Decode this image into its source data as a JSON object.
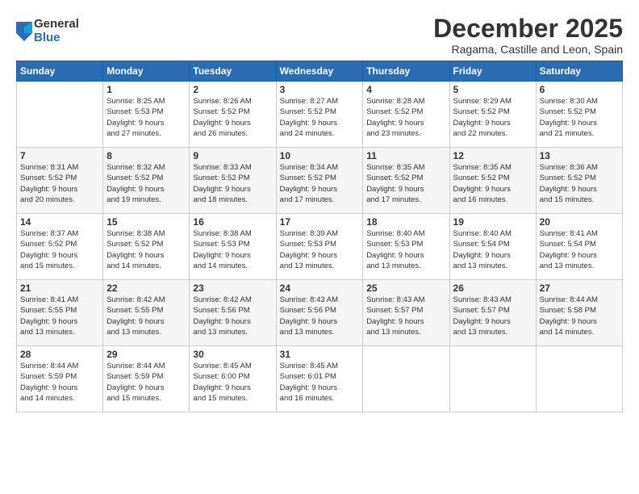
{
  "logo": {
    "general": "General",
    "blue": "Blue"
  },
  "header": {
    "title": "December 2025",
    "subtitle": "Ragama, Castille and Leon, Spain"
  },
  "weekdays": [
    "Sunday",
    "Monday",
    "Tuesday",
    "Wednesday",
    "Thursday",
    "Friday",
    "Saturday"
  ],
  "weeks": [
    [
      {
        "day": "",
        "info": ""
      },
      {
        "day": "1",
        "info": "Sunrise: 8:25 AM\nSunset: 5:53 PM\nDaylight: 9 hours\nand 27 minutes."
      },
      {
        "day": "2",
        "info": "Sunrise: 8:26 AM\nSunset: 5:52 PM\nDaylight: 9 hours\nand 26 minutes."
      },
      {
        "day": "3",
        "info": "Sunrise: 8:27 AM\nSunset: 5:52 PM\nDaylight: 9 hours\nand 24 minutes."
      },
      {
        "day": "4",
        "info": "Sunrise: 8:28 AM\nSunset: 5:52 PM\nDaylight: 9 hours\nand 23 minutes."
      },
      {
        "day": "5",
        "info": "Sunrise: 8:29 AM\nSunset: 5:52 PM\nDaylight: 9 hours\nand 22 minutes."
      },
      {
        "day": "6",
        "info": "Sunrise: 8:30 AM\nSunset: 5:52 PM\nDaylight: 9 hours\nand 21 minutes."
      }
    ],
    [
      {
        "day": "7",
        "info": "Sunrise: 8:31 AM\nSunset: 5:52 PM\nDaylight: 9 hours\nand 20 minutes."
      },
      {
        "day": "8",
        "info": "Sunrise: 8:32 AM\nSunset: 5:52 PM\nDaylight: 9 hours\nand 19 minutes."
      },
      {
        "day": "9",
        "info": "Sunrise: 8:33 AM\nSunset: 5:52 PM\nDaylight: 9 hours\nand 18 minutes."
      },
      {
        "day": "10",
        "info": "Sunrise: 8:34 AM\nSunset: 5:52 PM\nDaylight: 9 hours\nand 17 minutes."
      },
      {
        "day": "11",
        "info": "Sunrise: 8:35 AM\nSunset: 5:52 PM\nDaylight: 9 hours\nand 17 minutes."
      },
      {
        "day": "12",
        "info": "Sunrise: 8:35 AM\nSunset: 5:52 PM\nDaylight: 9 hours\nand 16 minutes."
      },
      {
        "day": "13",
        "info": "Sunrise: 8:36 AM\nSunset: 5:52 PM\nDaylight: 9 hours\nand 15 minutes."
      }
    ],
    [
      {
        "day": "14",
        "info": "Sunrise: 8:37 AM\nSunset: 5:52 PM\nDaylight: 9 hours\nand 15 minutes."
      },
      {
        "day": "15",
        "info": "Sunrise: 8:38 AM\nSunset: 5:52 PM\nDaylight: 9 hours\nand 14 minutes."
      },
      {
        "day": "16",
        "info": "Sunrise: 8:38 AM\nSunset: 5:53 PM\nDaylight: 9 hours\nand 14 minutes."
      },
      {
        "day": "17",
        "info": "Sunrise: 8:39 AM\nSunset: 5:53 PM\nDaylight: 9 hours\nand 13 minutes."
      },
      {
        "day": "18",
        "info": "Sunrise: 8:40 AM\nSunset: 5:53 PM\nDaylight: 9 hours\nand 13 minutes."
      },
      {
        "day": "19",
        "info": "Sunrise: 8:40 AM\nSunset: 5:54 PM\nDaylight: 9 hours\nand 13 minutes."
      },
      {
        "day": "20",
        "info": "Sunrise: 8:41 AM\nSunset: 5:54 PM\nDaylight: 9 hours\nand 13 minutes."
      }
    ],
    [
      {
        "day": "21",
        "info": "Sunrise: 8:41 AM\nSunset: 5:55 PM\nDaylight: 9 hours\nand 13 minutes."
      },
      {
        "day": "22",
        "info": "Sunrise: 8:42 AM\nSunset: 5:55 PM\nDaylight: 9 hours\nand 13 minutes."
      },
      {
        "day": "23",
        "info": "Sunrise: 8:42 AM\nSunset: 5:56 PM\nDaylight: 9 hours\nand 13 minutes."
      },
      {
        "day": "24",
        "info": "Sunrise: 8:43 AM\nSunset: 5:56 PM\nDaylight: 9 hours\nand 13 minutes."
      },
      {
        "day": "25",
        "info": "Sunrise: 8:43 AM\nSunset: 5:57 PM\nDaylight: 9 hours\nand 13 minutes."
      },
      {
        "day": "26",
        "info": "Sunrise: 8:43 AM\nSunset: 5:57 PM\nDaylight: 9 hours\nand 13 minutes."
      },
      {
        "day": "27",
        "info": "Sunrise: 8:44 AM\nSunset: 5:58 PM\nDaylight: 9 hours\nand 14 minutes."
      }
    ],
    [
      {
        "day": "28",
        "info": "Sunrise: 8:44 AM\nSunset: 5:59 PM\nDaylight: 9 hours\nand 14 minutes."
      },
      {
        "day": "29",
        "info": "Sunrise: 8:44 AM\nSunset: 5:59 PM\nDaylight: 9 hours\nand 15 minutes."
      },
      {
        "day": "30",
        "info": "Sunrise: 8:45 AM\nSunset: 6:00 PM\nDaylight: 9 hours\nand 15 minutes."
      },
      {
        "day": "31",
        "info": "Sunrise: 8:45 AM\nSunset: 6:01 PM\nDaylight: 9 hours\nand 16 minutes."
      },
      {
        "day": "",
        "info": ""
      },
      {
        "day": "",
        "info": ""
      },
      {
        "day": "",
        "info": ""
      }
    ]
  ]
}
